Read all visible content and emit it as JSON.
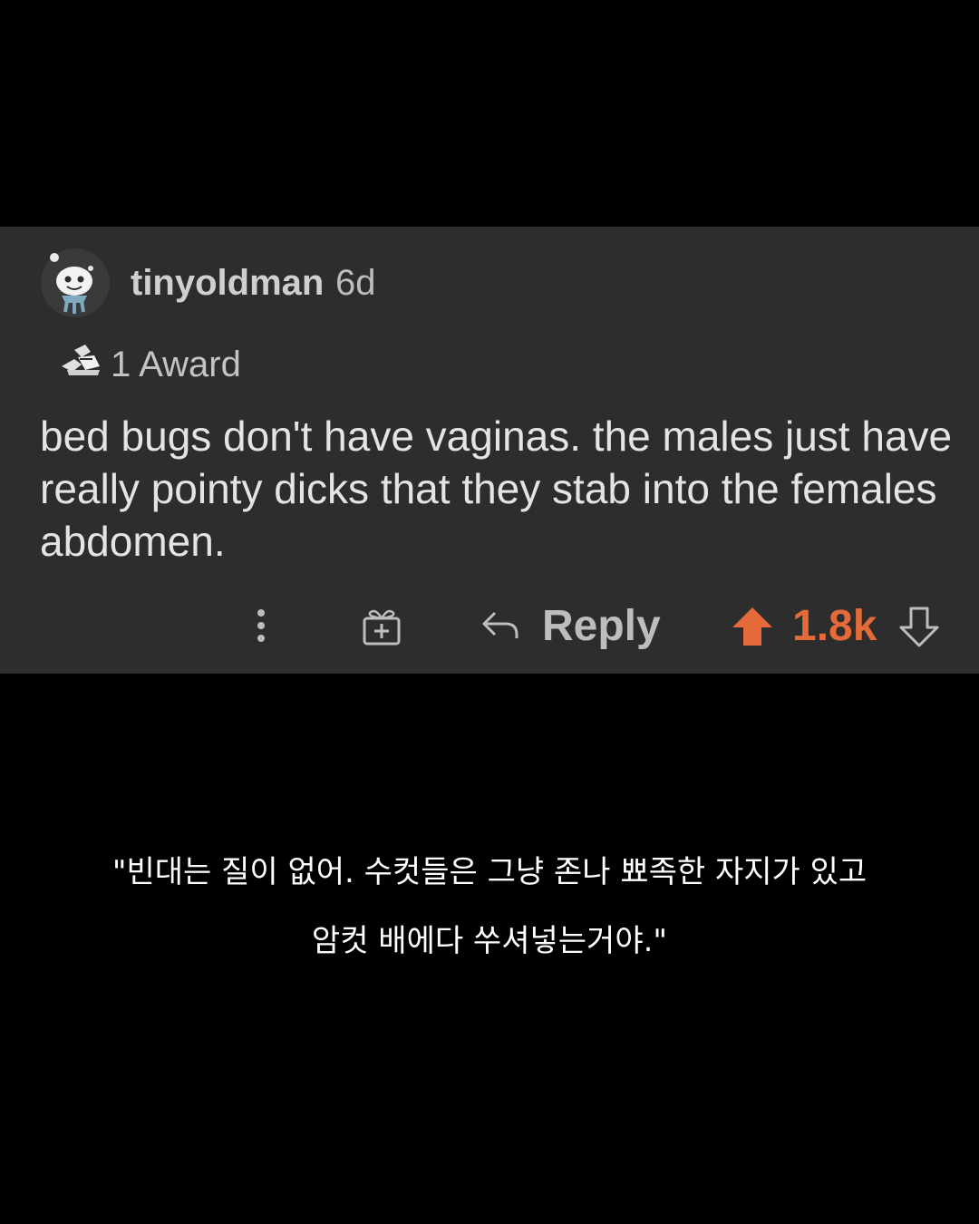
{
  "comment": {
    "username": "tinyoldman",
    "age": "6d",
    "award_text": "1 Award",
    "body": "bed bugs don't have vaginas. the males just have really pointy dicks that they stab into the females abdomen.",
    "reply_label": "Reply",
    "vote_count": "1.8k",
    "icons": {
      "avatar": "snoo-avatar-icon",
      "award": "award-icon",
      "more": "more-options-icon",
      "gift": "gift-award-icon",
      "reply": "reply-arrow-icon",
      "upvote": "upvote-arrow-icon",
      "downvote": "downvote-arrow-icon"
    }
  },
  "caption": {
    "line1": "\"빈대는 질이 없어. 수컷들은 그냥 존나 뾰족한 자지가 있고",
    "line2": "암컷 배에다 쑤셔넣는거야.\""
  },
  "colors": {
    "background": "#000000",
    "card": "#2d2d2d",
    "username": "#cfcfcf",
    "body_text": "#e4e4e4",
    "upvote_accent": "#e56a3a",
    "caption_text": "#ffffff"
  }
}
